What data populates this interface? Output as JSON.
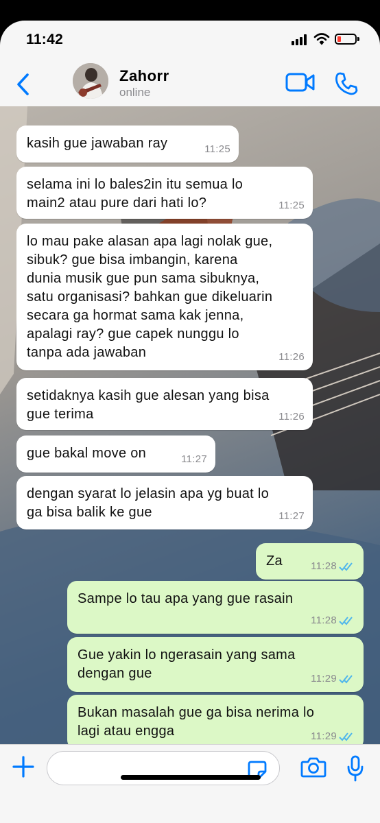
{
  "status_bar": {
    "time": "11:42",
    "battery_level": 0.2
  },
  "header": {
    "contact_name": "Zahorr",
    "contact_status": "online"
  },
  "messages": [
    {
      "direction": "in",
      "text": "kasih gue jawaban ray",
      "time": "11:25"
    },
    {
      "direction": "in",
      "text": "selama ini lo bales2in itu semua lo\nmain2 atau pure dari hati lo?",
      "time": "11:25"
    },
    {
      "direction": "in",
      "text": "lo mau pake alasan apa lagi nolak gue,\nsibuk? gue bisa imbangin, karena\ndunia musik gue pun sama sibuknya,\nsatu organisasi? bahkan gue dikeluarin\nsecara ga hormat sama kak jenna,\napalagi ray? gue capek nunggu lo\ntanpa ada jawaban",
      "time": "11:26"
    },
    {
      "direction": "in",
      "text": "setidaknya kasih gue alesan yang bisa\ngue terima",
      "time": "11:26"
    },
    {
      "direction": "in",
      "text": "gue bakal move on",
      "time": "11:27"
    },
    {
      "direction": "in",
      "text": "dengan syarat lo jelasin apa yg buat lo\nga bisa balik ke gue",
      "time": "11:27"
    },
    {
      "direction": "out",
      "text": "Za",
      "time": "11:28",
      "status": "read"
    },
    {
      "direction": "out",
      "text": "Sampe lo tau apa yang gue rasain",
      "time": "11:28",
      "status": "read"
    },
    {
      "direction": "out",
      "text": "Gue yakin lo ngerasain yang sama\ndengan gue",
      "time": "11:29",
      "status": "read"
    },
    {
      "direction": "out",
      "text": "Bukan masalah gue ga bisa nerima lo\nlagi atau engga",
      "time": "11:29",
      "status": "read"
    }
  ],
  "composer": {
    "input_value": ""
  },
  "colors": {
    "accent": "#007aff",
    "incoming_bubble": "#ffffff",
    "outgoing_bubble": "#dcf8c6",
    "read_ticks": "#4fb6ec"
  },
  "icons": {
    "back": "chevron-left-icon",
    "video": "video-camera-icon",
    "call": "phone-icon",
    "plus": "plus-icon",
    "sticker": "sticker-icon",
    "camera": "camera-icon",
    "mic": "microphone-icon"
  }
}
